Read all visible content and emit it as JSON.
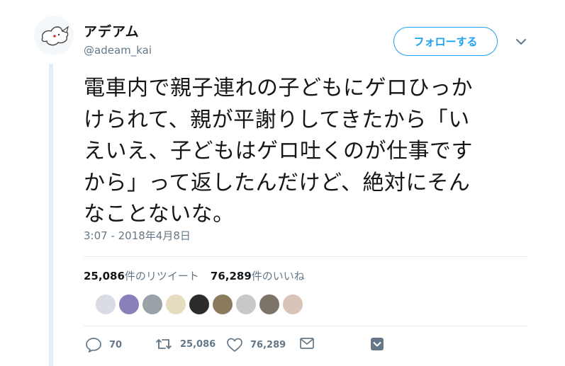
{
  "user": {
    "display_name": "アデアム",
    "screen_name": "@adeam_kai"
  },
  "header": {
    "follow_label": "フォローする",
    "caret_icon": "chevron-down-icon"
  },
  "tweet": {
    "lines": [
      "電車内で親子連れの子どもにゲロひっか",
      "けられて、親が平謝りしてきたから「い",
      "えいえ、子どもはゲロ吐くのが仕事です",
      "から」って返したんだけど、絶対にそん",
      "なことないな。"
    ],
    "timestamp": "3:07 - 2018年4月8日"
  },
  "stats": {
    "retweets_count": "25,086",
    "retweets_label": "件のリツイート",
    "likes_count": "76,289",
    "likes_label": "件のいいね"
  },
  "likers": {
    "colors": [
      "#d9dde3",
      "#8a7fb8",
      "#9aa2a8",
      "#e6dcc0",
      "#2c2c2c",
      "#8c7a5e",
      "#c8c8c8",
      "#7c7468",
      "#d8c4b8"
    ]
  },
  "actions": {
    "reply_count": "70",
    "retweet_count": "25,086",
    "like_count": "76,289"
  },
  "colors": {
    "accent": "#1da1f2",
    "muted": "#657786",
    "thread_line": "#e1effa"
  }
}
